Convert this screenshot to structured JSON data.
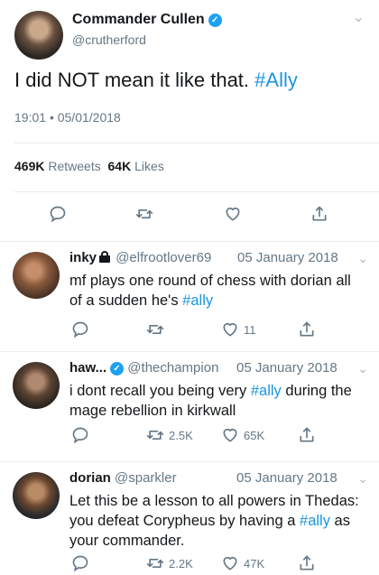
{
  "main_tweet": {
    "name": "Commander Cullen",
    "handle": "@crutherford",
    "text_before": "I did NOT mean it like that. ",
    "hashtag": "#Ally",
    "time": "19:01",
    "separator": "•",
    "date": "05/01/2018",
    "retweets_count": "469K",
    "retweets_label": "Retweets",
    "likes_count": "64K",
    "likes_label": "Likes"
  },
  "replies": [
    {
      "name": "inky",
      "handle": "@elfrootlover69",
      "date": "05 January 2018",
      "text_before": "mf plays one round of chess with dorian all of a sudden he's ",
      "hashtag": "#ally",
      "text_after": "",
      "retweets": "",
      "likes": "11",
      "locked": true
    },
    {
      "name": "haw...",
      "handle": "@thechampion",
      "date": "05 January 2018",
      "text_before": "i dont recall you being very ",
      "hashtag": "#ally",
      "text_after": " during the mage rebellion in kirkwall",
      "retweets": "2.5K",
      "likes": "65K",
      "verified": true
    },
    {
      "name": "dorian",
      "handle": "@sparkler",
      "date": "05 January 2018",
      "text_before": "Let this be a lesson to all powers in Thedas: you defeat Corypheus by having a ",
      "hashtag": "#ally",
      "text_after": " as your commander.",
      "retweets": "2.2K",
      "likes": "47K"
    }
  ],
  "colors": {
    "accent": "#1da1f2",
    "hashtag": "#1b95e0",
    "muted": "#657786",
    "divider": "#e6ecf0"
  }
}
